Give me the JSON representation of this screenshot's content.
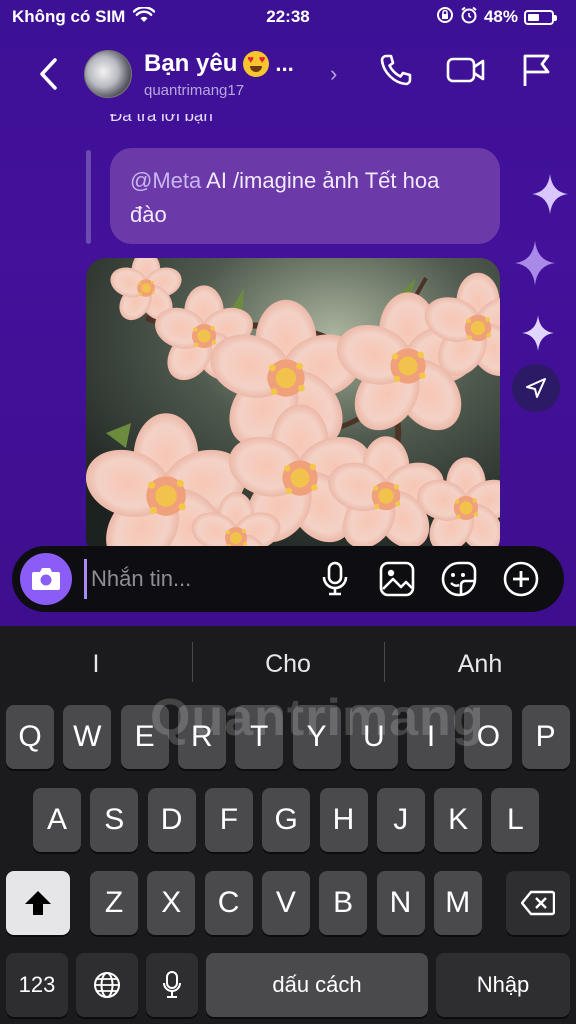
{
  "status_bar": {
    "carrier": "Không có SIM",
    "time": "22:38",
    "battery": "48%",
    "battery_level": 0.48
  },
  "header": {
    "contact_name": "Bạn yêu",
    "ellipsis": "...",
    "username": "quantrimang17"
  },
  "messages": {
    "reply_note": "Đã trả lời bạn",
    "quoted_mention": "@Meta",
    "quoted_rest": " AI /imagine ảnh Tết hoa đào"
  },
  "composer": {
    "placeholder": "Nhắn tin..."
  },
  "keyboard": {
    "suggestions": [
      "I",
      "Cho",
      "Anh"
    ],
    "row1": [
      "Q",
      "W",
      "E",
      "R",
      "T",
      "Y",
      "U",
      "I",
      "O",
      "P"
    ],
    "row2": [
      "A",
      "S",
      "D",
      "F",
      "G",
      "H",
      "J",
      "K",
      "L"
    ],
    "row3": [
      "Z",
      "X",
      "C",
      "V",
      "B",
      "N",
      "M"
    ],
    "numbers_label": "123",
    "space_label": "dấu cách",
    "return_label": "Nhập"
  },
  "watermark": "Quantrimang",
  "colors": {
    "chat_bg": "#3c1196",
    "accent": "#8b5cf6",
    "bubble": "#6b3aa8",
    "keyboard_bg": "#1b1b1d"
  }
}
